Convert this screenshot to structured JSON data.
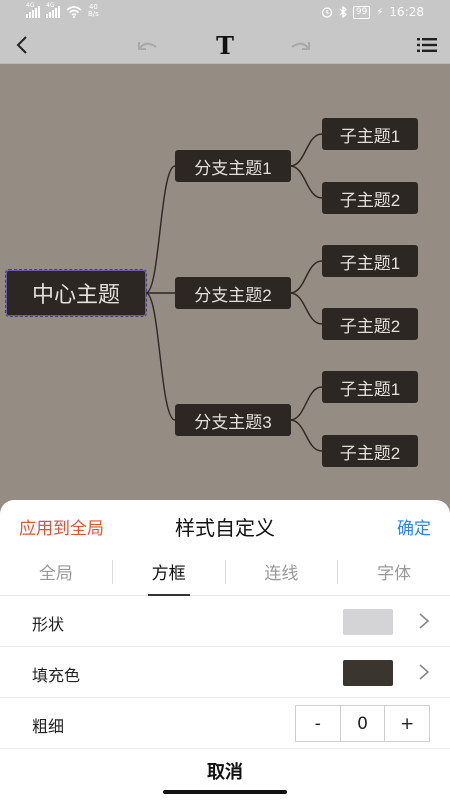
{
  "status_bar": {
    "signal1_label": "4G",
    "signal2_label": "4G",
    "net_speed_value": "40",
    "net_speed_unit": "B/s",
    "battery": "99",
    "time": "16:28"
  },
  "toolbar": {
    "back_icon": "chevron-left-icon",
    "undo_icon": "undo-icon",
    "text_style_label": "T",
    "redo_icon": "redo-icon",
    "outline_icon": "list-icon"
  },
  "mindmap": {
    "root": "中心主题",
    "branches": [
      {
        "label": "分支主题1",
        "children": [
          "子主题1",
          "子主题2"
        ]
      },
      {
        "label": "分支主题2",
        "children": [
          "子主题1",
          "子主题2"
        ]
      },
      {
        "label": "分支主题3",
        "children": [
          "子主题1",
          "子主题2"
        ]
      }
    ]
  },
  "sheet": {
    "apply_all": "应用到全局",
    "title": "样式自定义",
    "confirm": "确定",
    "tabs": [
      "全局",
      "方框",
      "连线",
      "字体"
    ],
    "active_tab": "方框",
    "shape_label": "形状",
    "fill_label": "填充色",
    "fill_color": "#3a352e",
    "shape_color": "#d4d3d6",
    "thickness_label": "粗细",
    "thickness_minus": "-",
    "thickness_value": "0",
    "thickness_plus": "+",
    "cancel": "取消"
  },
  "colors": {
    "accent_red": "#e0533e",
    "accent_blue": "#2f82e6",
    "canvas_bg": "#958c83",
    "node_bg": "#2d2723"
  }
}
